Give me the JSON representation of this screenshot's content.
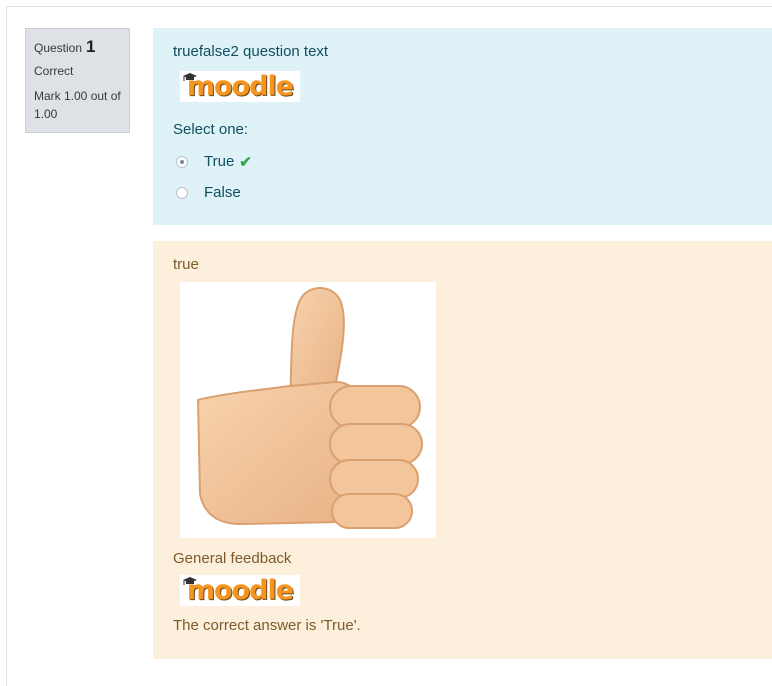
{
  "question_info": {
    "label": "Question",
    "number": "1",
    "state": "Correct",
    "grade": "Mark 1.00 out of 1.00"
  },
  "question": {
    "text": "truefalse2 question text",
    "logo_text": "moodle",
    "prompt": "Select one:",
    "options": [
      {
        "label": "True",
        "selected": true,
        "correct": true
      },
      {
        "label": "False",
        "selected": false,
        "correct": false
      }
    ]
  },
  "feedback": {
    "specific": "true",
    "general_label": "General feedback",
    "logo_text": "moodle",
    "right_answer": "The correct answer is 'True'."
  },
  "colors": {
    "info_bg": "#dee2e6",
    "formulation_bg": "#def2f8",
    "outcome_bg": "#fcefdc",
    "correct_check": "#3aa34f",
    "moodle_orange": "#f7941e"
  },
  "icons": [
    "graduation-cap-icon",
    "check-icon",
    "thumbs-up-icon"
  ]
}
